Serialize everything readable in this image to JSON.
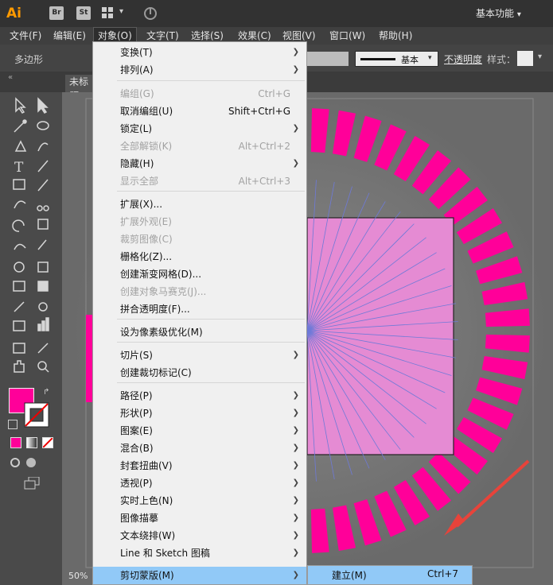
{
  "titlebar": {
    "app_logo": "Ai",
    "bridge_button": "Br",
    "stock_button": "St",
    "workspace_label": "基本功能"
  },
  "menubar": {
    "items": [
      "文件(F)",
      "编辑(E)",
      "对象(O)",
      "文字(T)",
      "选择(S)",
      "效果(C)",
      "视图(V)",
      "窗口(W)",
      "帮助(H)"
    ]
  },
  "controlbar": {
    "shape_label": "多边形",
    "stroke_style_label": "基本",
    "opacity_label": "不透明度",
    "style_label": "样式："
  },
  "document": {
    "tab_label": "未标题",
    "zoom": "50%"
  },
  "object_menu": {
    "items": [
      {
        "label": "变换(T)",
        "shortcut": "",
        "submenu": true,
        "disabled": false
      },
      {
        "label": "排列(A)",
        "shortcut": "",
        "submenu": true,
        "disabled": false
      },
      {
        "label": "编组(G)",
        "shortcut": "Ctrl+G",
        "submenu": false,
        "disabled": true
      },
      {
        "label": "取消编组(U)",
        "shortcut": "Shift+Ctrl+G",
        "submenu": false,
        "disabled": false
      },
      {
        "label": "锁定(L)",
        "shortcut": "",
        "submenu": true,
        "disabled": false
      },
      {
        "label": "全部解锁(K)",
        "shortcut": "Alt+Ctrl+2",
        "submenu": false,
        "disabled": true
      },
      {
        "label": "隐藏(H)",
        "shortcut": "",
        "submenu": true,
        "disabled": false
      },
      {
        "label": "显示全部",
        "shortcut": "Alt+Ctrl+3",
        "submenu": false,
        "disabled": true
      },
      {
        "label": "扩展(X)...",
        "shortcut": "",
        "submenu": false,
        "disabled": false
      },
      {
        "label": "扩展外观(E)",
        "shortcut": "",
        "submenu": false,
        "disabled": true
      },
      {
        "label": "裁剪图像(C)",
        "shortcut": "",
        "submenu": false,
        "disabled": true
      },
      {
        "label": "栅格化(Z)...",
        "shortcut": "",
        "submenu": false,
        "disabled": false
      },
      {
        "label": "创建渐变网格(D)...",
        "shortcut": "",
        "submenu": false,
        "disabled": false
      },
      {
        "label": "创建对象马赛克(J)...",
        "shortcut": "",
        "submenu": false,
        "disabled": true
      },
      {
        "label": "拼合透明度(F)...",
        "shortcut": "",
        "submenu": false,
        "disabled": false
      },
      {
        "label": "设为像素级优化(M)",
        "shortcut": "",
        "submenu": false,
        "disabled": false
      },
      {
        "label": "切片(S)",
        "shortcut": "",
        "submenu": true,
        "disabled": false
      },
      {
        "label": "创建裁切标记(C)",
        "shortcut": "",
        "submenu": false,
        "disabled": false
      },
      {
        "label": "路径(P)",
        "shortcut": "",
        "submenu": true,
        "disabled": false
      },
      {
        "label": "形状(P)",
        "shortcut": "",
        "submenu": true,
        "disabled": false
      },
      {
        "label": "图案(E)",
        "shortcut": "",
        "submenu": true,
        "disabled": false
      },
      {
        "label": "混合(B)",
        "shortcut": "",
        "submenu": true,
        "disabled": false
      },
      {
        "label": "封套扭曲(V)",
        "shortcut": "",
        "submenu": true,
        "disabled": false
      },
      {
        "label": "透视(P)",
        "shortcut": "",
        "submenu": true,
        "disabled": false
      },
      {
        "label": "实时上色(N)",
        "shortcut": "",
        "submenu": true,
        "disabled": false
      },
      {
        "label": "图像描摹",
        "shortcut": "",
        "submenu": true,
        "disabled": false
      },
      {
        "label": "文本绕排(W)",
        "shortcut": "",
        "submenu": true,
        "disabled": false
      },
      {
        "label": "Line 和 Sketch 图稿",
        "shortcut": "",
        "submenu": true,
        "disabled": false
      },
      {
        "label": "剪切蒙版(M)",
        "shortcut": "",
        "submenu": true,
        "disabled": false,
        "highlighted": true
      }
    ]
  },
  "clipping_submenu": {
    "items": [
      {
        "label": "建立(M)",
        "shortcut": "Ctrl+7"
      }
    ]
  },
  "colors": {
    "accent": "#ff0099",
    "fill_swatch": "#ff0099",
    "menu_highlight": "#91c9f7"
  }
}
